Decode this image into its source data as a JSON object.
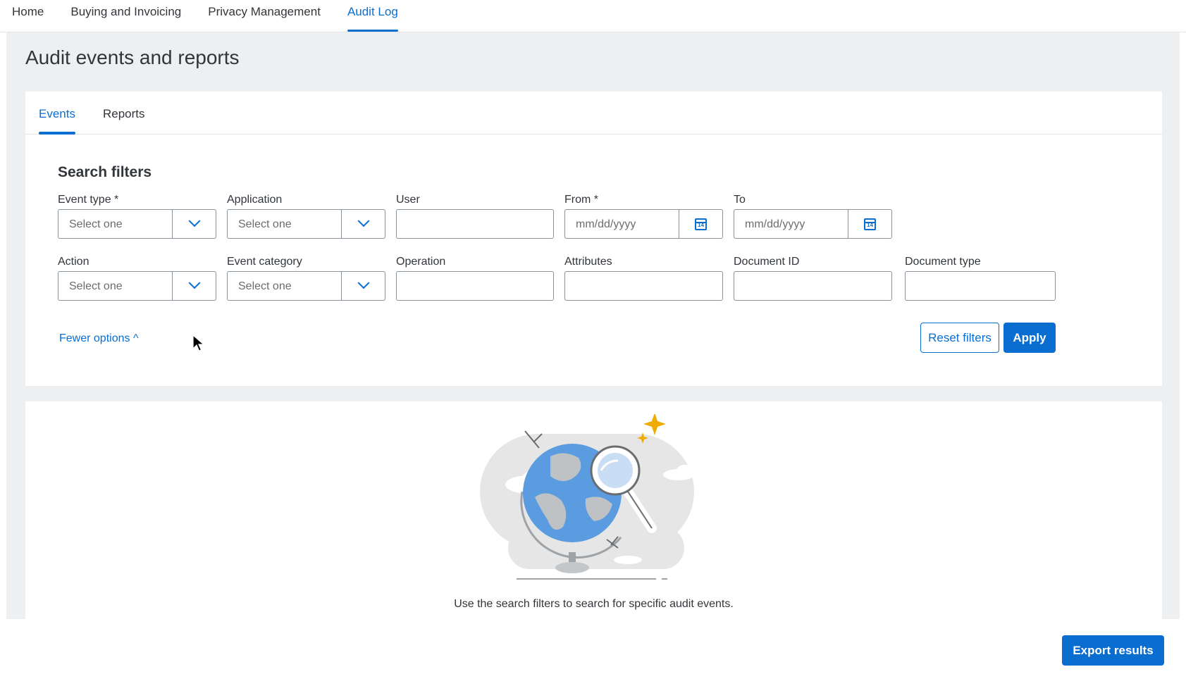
{
  "topnav": {
    "items": [
      {
        "label": "Home"
      },
      {
        "label": "Buying and Invoicing"
      },
      {
        "label": "Privacy Management"
      },
      {
        "label": "Audit Log"
      }
    ],
    "active": "Audit Log"
  },
  "page": {
    "title": "Audit events and reports"
  },
  "tabs": {
    "items": [
      {
        "label": "Events"
      },
      {
        "label": "Reports"
      }
    ],
    "active": "Events"
  },
  "filters": {
    "title": "Search filters",
    "event_type": {
      "label": "Event type *",
      "placeholder": "Select one"
    },
    "application": {
      "label": "Application",
      "placeholder": "Select one"
    },
    "user": {
      "label": "User",
      "value": ""
    },
    "from": {
      "label": "From *",
      "placeholder": "mm/dd/yyyy"
    },
    "to": {
      "label": "To",
      "placeholder": "mm/dd/yyyy"
    },
    "action": {
      "label": "Action",
      "placeholder": "Select one"
    },
    "event_category": {
      "label": "Event category",
      "placeholder": "Select one"
    },
    "operation": {
      "label": "Operation",
      "value": ""
    },
    "attributes": {
      "label": "Attributes",
      "value": ""
    },
    "document_id": {
      "label": "Document ID",
      "value": ""
    },
    "document_type": {
      "label": "Document type",
      "value": ""
    },
    "calendar_day": "14",
    "fewer_options": "Fewer options ^",
    "reset_label": "Reset filters",
    "apply_label": "Apply"
  },
  "results": {
    "empty_message": "Use the search filters to search for specific audit events."
  },
  "footer": {
    "export_label": "Export results"
  },
  "colors": {
    "accent": "#0a6ed1",
    "shell_bg": "#edeff0",
    "text": "#32363a"
  }
}
